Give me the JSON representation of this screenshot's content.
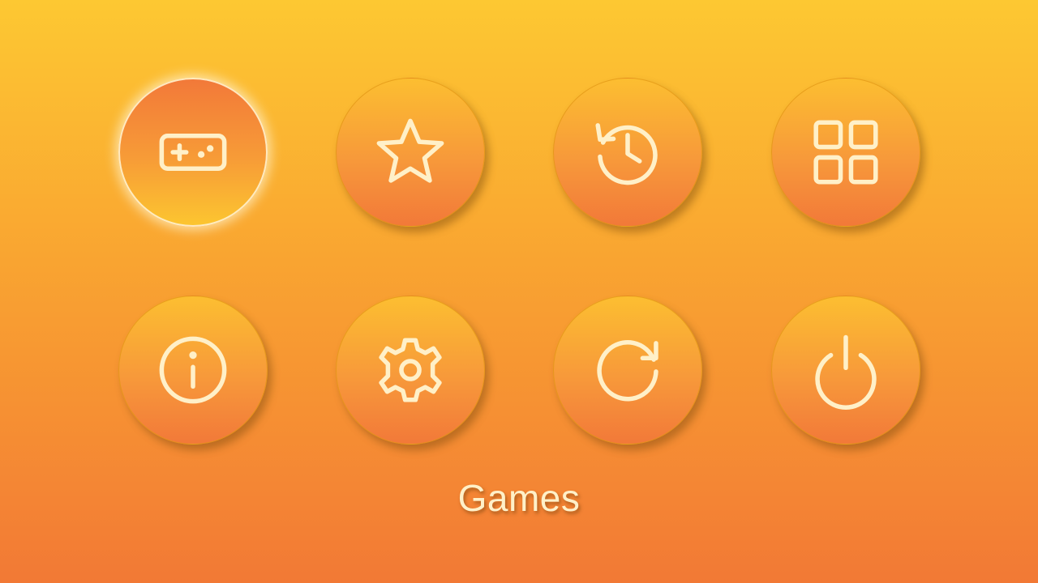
{
  "menu": {
    "selected_label": "Games",
    "tiles": [
      {
        "icon": "gamepad-icon",
        "selected": true
      },
      {
        "icon": "star-icon",
        "selected": false
      },
      {
        "icon": "history-icon",
        "selected": false
      },
      {
        "icon": "apps-grid-icon",
        "selected": false
      },
      {
        "icon": "info-icon",
        "selected": false
      },
      {
        "icon": "gear-icon",
        "selected": false
      },
      {
        "icon": "refresh-icon",
        "selected": false
      },
      {
        "icon": "power-icon",
        "selected": false
      }
    ]
  },
  "colors": {
    "background_top": "#fdc832",
    "background_bottom": "#f27935",
    "icon_color": "#fff0c8"
  }
}
